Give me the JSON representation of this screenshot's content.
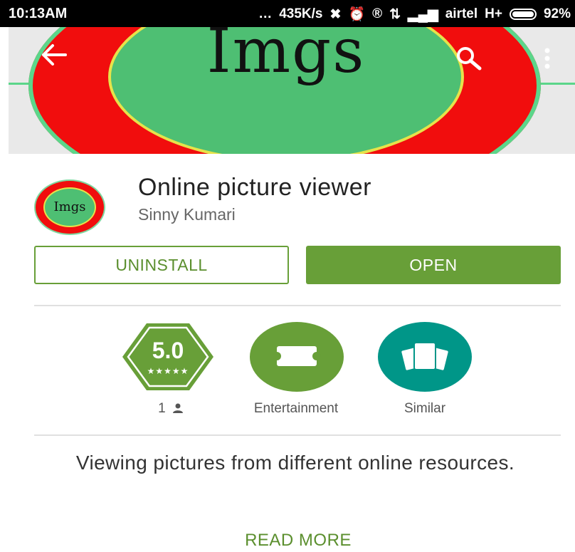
{
  "status_bar": {
    "time": "10:13AM",
    "speed": "435K/s",
    "carrier": "airtel",
    "network": "H+",
    "battery": "92%"
  },
  "banner": {
    "logo_text": "Imgs",
    "ring_color": "#f10d0d",
    "inner_color": "#4ebf73"
  },
  "app": {
    "icon_text": "Imgs",
    "title": "Online picture viewer",
    "developer": "Sinny Kumari"
  },
  "actions": {
    "uninstall_label": "UNINSTALL",
    "open_label": "OPEN",
    "accent_color": "#689f38"
  },
  "badges": {
    "rating_value": "5.0",
    "rating_stars": "★★★★★",
    "rating_count": "1",
    "category_label": "Entertainment",
    "similar_label": "Similar",
    "similar_color": "#009688"
  },
  "description": {
    "text": "Viewing pictures from different online resources.",
    "read_more_label": "READ MORE"
  },
  "icons": [
    "back-arrow-icon",
    "search-icon",
    "more-vert-icon",
    "ticket-icon",
    "cards-icon",
    "person-icon"
  ]
}
